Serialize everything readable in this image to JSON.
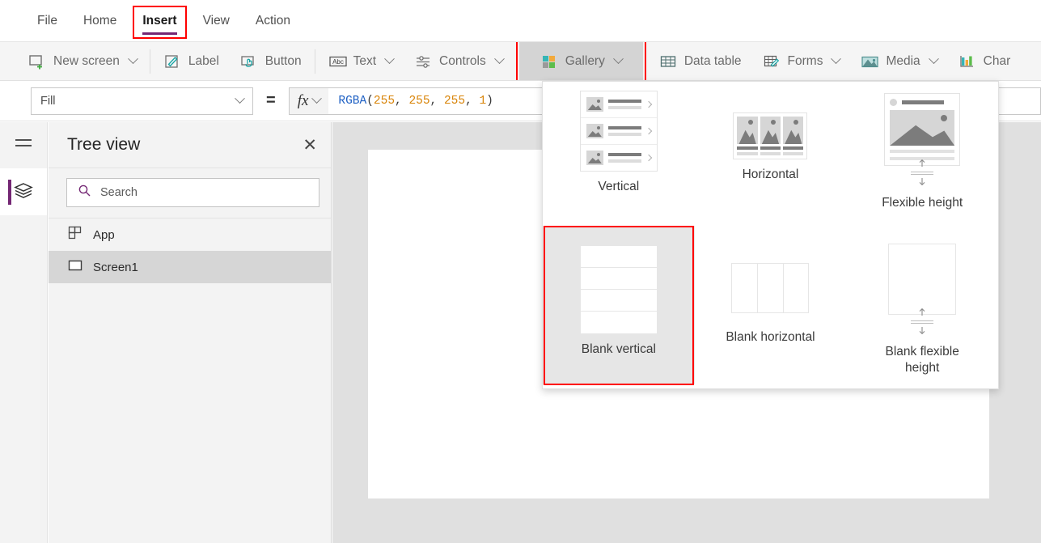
{
  "menu": {
    "items": [
      {
        "label": "File",
        "active": false
      },
      {
        "label": "Home",
        "active": false
      },
      {
        "label": "Insert",
        "active": true
      },
      {
        "label": "View",
        "active": false
      },
      {
        "label": "Action",
        "active": false
      }
    ],
    "active_accent": "#742774",
    "highlight_color": "#ff0000"
  },
  "ribbon": {
    "items": [
      {
        "label": "New screen",
        "icon": "new-screen-icon",
        "caret": true
      },
      {
        "label": "Label",
        "icon": "label-icon",
        "caret": false
      },
      {
        "label": "Button",
        "icon": "button-icon",
        "caret": false
      },
      {
        "label": "Text",
        "icon": "text-icon",
        "caret": true
      },
      {
        "label": "Controls",
        "icon": "controls-icon",
        "caret": true
      },
      {
        "label": "Gallery",
        "icon": "gallery-icon",
        "caret": true,
        "selected": true
      },
      {
        "label": "Data table",
        "icon": "data-table-icon",
        "caret": false
      },
      {
        "label": "Forms",
        "icon": "forms-icon",
        "caret": true
      },
      {
        "label": "Media",
        "icon": "media-icon",
        "caret": true
      },
      {
        "label": "Char",
        "icon": "charts-icon",
        "caret": false
      }
    ]
  },
  "formula_bar": {
    "property": "Fill",
    "equals": "=",
    "fx_label": "fx",
    "formula_parts": [
      {
        "text": "RGBA",
        "type": "fn"
      },
      {
        "text": "(",
        "type": "punct"
      },
      {
        "text": "255",
        "type": "num"
      },
      {
        "text": ", ",
        "type": "punct"
      },
      {
        "text": "255",
        "type": "num"
      },
      {
        "text": ", ",
        "type": "punct"
      },
      {
        "text": "255",
        "type": "num"
      },
      {
        "text": ", ",
        "type": "punct"
      },
      {
        "text": "1",
        "type": "num"
      },
      {
        "text": ")",
        "type": "punct"
      }
    ],
    "formula_text": "RGBA(255, 255, 255, 1)"
  },
  "left_rail": {
    "menu_icon": "hamburger-menu-icon",
    "active_icon": "tree-view-layers-icon",
    "accent": "#742774"
  },
  "tree_view": {
    "title": "Tree view",
    "close_label": "✕",
    "search": {
      "placeholder": "Search",
      "value": ""
    },
    "items": [
      {
        "label": "App",
        "icon": "app-icon",
        "selected": false
      },
      {
        "label": "Screen1",
        "icon": "screen-icon",
        "selected": true
      }
    ]
  },
  "gallery_flyout": {
    "options": [
      {
        "label": "Vertical",
        "thumb": "vertical",
        "highlighted": false
      },
      {
        "label": "Horizontal",
        "thumb": "horizontal",
        "highlighted": false
      },
      {
        "label": "Flexible height",
        "thumb": "flexible-height",
        "highlighted": false
      },
      {
        "label": "Blank vertical",
        "thumb": "blank-vertical",
        "highlighted": true
      },
      {
        "label": "Blank horizontal",
        "thumb": "blank-horizontal",
        "highlighted": false
      },
      {
        "label": "Blank flexible height",
        "thumb": "blank-flexible-height",
        "highlighted": false
      }
    ]
  },
  "canvas": {
    "screen_name": "Screen1",
    "screen_fill": "#ffffff",
    "background": "#e0e0e0"
  }
}
